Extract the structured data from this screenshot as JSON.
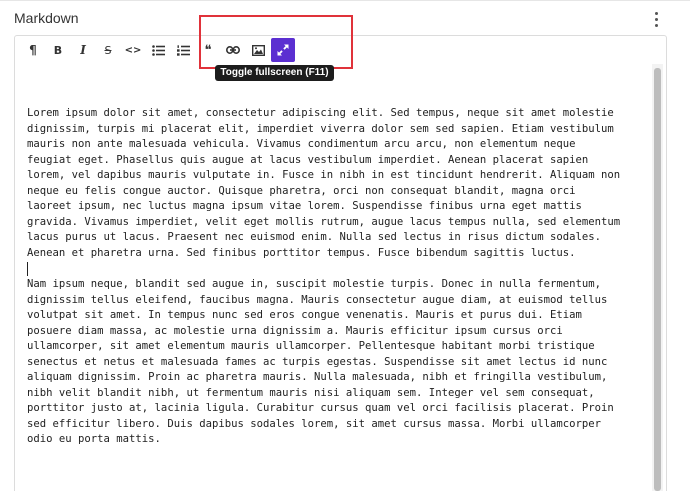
{
  "section": {
    "title": "Markdown",
    "menu_icon": "kebab-vertical-icon"
  },
  "toolbar": {
    "buttons": [
      {
        "name": "heading-button",
        "icon": "pilcrow-icon",
        "glyph": "¶"
      },
      {
        "name": "bold-button",
        "icon": "bold-icon",
        "glyph": "B"
      },
      {
        "name": "italic-button",
        "icon": "italic-icon",
        "glyph": "I"
      },
      {
        "name": "strikethrough-button",
        "icon": "strikethrough-icon",
        "glyph": "S"
      },
      {
        "name": "code-button",
        "icon": "code-icon",
        "glyph": "<>"
      },
      {
        "name": "bulleted-list-button",
        "icon": "bulleted-list-icon"
      },
      {
        "name": "numbered-list-button",
        "icon": "numbered-list-icon"
      },
      {
        "name": "blockquote-button",
        "icon": "quote-icon",
        "glyph": "❝"
      },
      {
        "name": "link-button",
        "icon": "link-icon"
      },
      {
        "name": "image-button",
        "icon": "image-icon"
      },
      {
        "name": "fullscreen-button",
        "icon": "expand-icon",
        "active": true
      }
    ],
    "tooltip": "Toggle fullscreen (F11)",
    "active_color": "#5b2fd1",
    "highlight_color": "#e0323a"
  },
  "content": {
    "paragraph1": [
      "Lorem ipsum dolor sit amet, consectetur adipiscing elit. Sed tempus, neque sit amet molestie",
      "dignissim, turpis mi placerat elit, imperdiet viverra dolor sem sed sapien. Etiam vestibulum",
      "mauris non ante malesuada vehicula. Vivamus condimentum arcu arcu, non elementum neque",
      "feugiat eget. Phasellus quis augue at lacus vestibulum imperdiet. Aenean placerat sapien",
      "lorem, vel dapibus mauris vulputate in. Fusce in nibh in est tincidunt hendrerit. Aliquam non",
      "neque eu felis congue auctor. Quisque pharetra, orci non consequat blandit, magna orci",
      "laoreet ipsum, nec luctus magna ipsum vitae lorem. Suspendisse finibus urna eget mattis",
      "gravida. Vivamus imperdiet, velit eget mollis rutrum, augue lacus tempus nulla, sed elementum",
      "lacus purus ut lacus. Praesent nec euismod enim. Nulla sed lectus in risus dictum sodales.",
      "Aenean et pharetra urna. Sed finibus porttitor tempus. Fusce bibendum sagittis luctus."
    ],
    "paragraph2": [
      "Nam ipsum neque, blandit sed augue in, suscipit molestie turpis. Donec in nulla fermentum,",
      "dignissim tellus eleifend, faucibus magna. Mauris consectetur augue diam, at euismod tellus",
      "volutpat sit amet. In tempus nunc sed eros congue venenatis. Mauris et purus dui. Etiam",
      "posuere diam massa, ac molestie urna dignissim a. Mauris efficitur ipsum cursus orci",
      "ullamcorper, sit amet elementum mauris ullamcorper. Pellentesque habitant morbi tristique",
      "senectus et netus et malesuada fames ac turpis egestas. Suspendisse sit amet lectus id nunc",
      "aliquam dignissim. Proin ac pharetra mauris. Nulla malesuada, nibh et fringilla vestibulum,",
      "nibh velit blandit nibh, ut fermentum mauris nisi aliquam sem. Integer vel sem consequat,",
      "porttitor justo at, lacinia ligula. Curabitur cursus quam vel orci facilisis placerat. Proin",
      "sed efficitur libero. Duis dapibus sodales lorem, sit amet cursus massa. Morbi ullamcorper",
      "odio eu porta mattis."
    ]
  }
}
